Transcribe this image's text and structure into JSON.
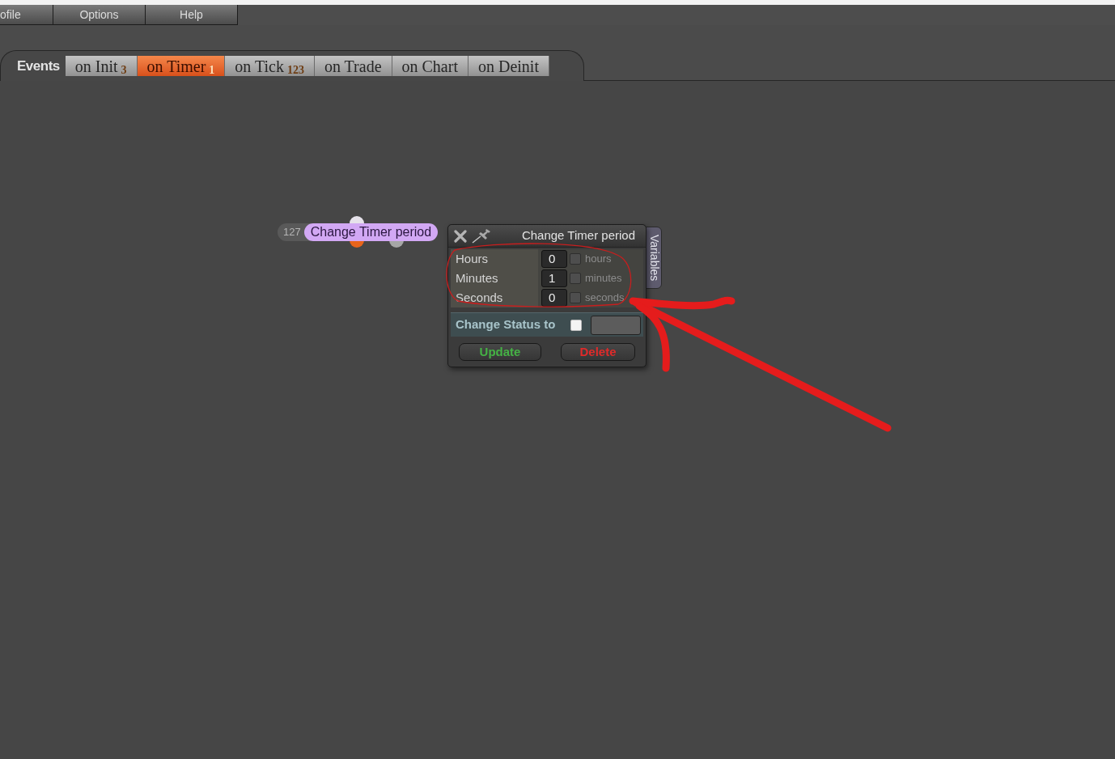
{
  "menu": [
    {
      "label": "ofile"
    },
    {
      "label": "Options"
    },
    {
      "label": "Help"
    }
  ],
  "events_bar": {
    "title": "Events",
    "tabs": [
      {
        "label": "on Init",
        "count": "3",
        "selected": false
      },
      {
        "label": "on Timer",
        "count": "1",
        "selected": true
      },
      {
        "label": "on Tick",
        "count": "123",
        "selected": false
      },
      {
        "label": "on Trade",
        "selected": false
      },
      {
        "label": "on Chart",
        "selected": false
      },
      {
        "label": "on Deinit",
        "selected": false
      }
    ]
  },
  "node": {
    "number": "127",
    "title": "Change Timer period",
    "ports": [
      {
        "color": "#e6e2ea"
      },
      {
        "color": "#e8641c"
      },
      {
        "color": "#a6a6a6"
      }
    ]
  },
  "dialog": {
    "title": "Change Timer period",
    "side_tab": "Variables",
    "fields": [
      {
        "label": "Hours",
        "value": "0",
        "checked": false,
        "unit": "hours"
      },
      {
        "label": "Minutes",
        "value": "1",
        "checked": false,
        "unit": "minutes"
      },
      {
        "label": "Seconds",
        "value": "0",
        "checked": false,
        "unit": "seconds"
      }
    ],
    "status": {
      "label": "Change Status to",
      "checked": false
    },
    "buttons": [
      {
        "label": "Update",
        "kind": "update"
      },
      {
        "label": "Delete",
        "kind": "delete"
      }
    ]
  }
}
